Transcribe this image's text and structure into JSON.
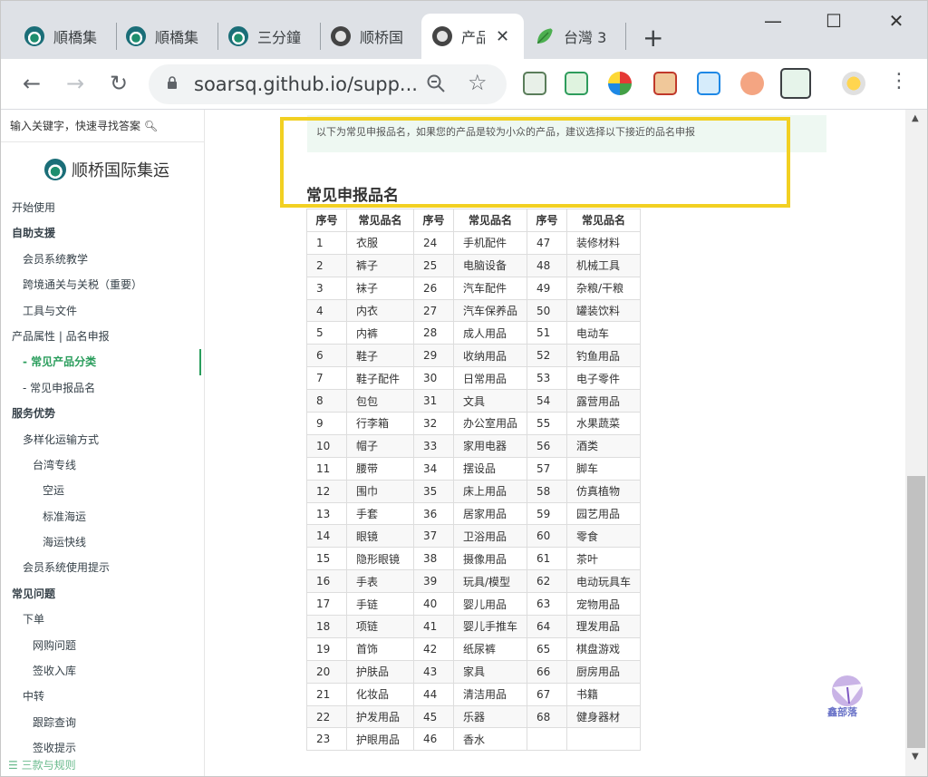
{
  "browser": {
    "tabs": [
      {
        "title": "順橋集",
        "icon": "boat-logo-icon",
        "active": false
      },
      {
        "title": "順橋集",
        "icon": "boat-logo-icon",
        "active": false
      },
      {
        "title": "三分鐘",
        "icon": "boat-logo-icon",
        "active": false
      },
      {
        "title": "顺桥国",
        "icon": "globe-icon",
        "active": false
      },
      {
        "title": "产品",
        "icon": "globe-icon",
        "active": true
      },
      {
        "title": "台灣 3",
        "icon": "leaf-icon",
        "active": false
      }
    ],
    "url": "soarsq.github.io/supp...",
    "window_controls": {
      "minimize": "—",
      "maximize": "☐",
      "close": "✕"
    }
  },
  "sidebar": {
    "search_placeholder": "输入关键字，快速寻找答案",
    "logo_text": "顺桥国际集运",
    "items": [
      {
        "label": "开始使用",
        "level": 0,
        "bold": false
      },
      {
        "label": "自助支援",
        "level": 0,
        "bold": true
      },
      {
        "label": "会员系统教学",
        "level": 1,
        "bold": false
      },
      {
        "label": "跨境通关与关税（重要）",
        "level": 1,
        "bold": false
      },
      {
        "label": "工具与文件",
        "level": 1,
        "bold": false
      },
      {
        "label": "产品属性 | 品名申报",
        "level": 0,
        "bold": false
      },
      {
        "label": "- 常见产品分类",
        "level": 1,
        "bold": true,
        "active": true
      },
      {
        "label": "- 常见申报品名",
        "level": 1,
        "bold": false
      },
      {
        "label": "服务优势",
        "level": 0,
        "bold": true
      },
      {
        "label": "多样化运输方式",
        "level": 1,
        "bold": false
      },
      {
        "label": "台湾专线",
        "level": 2,
        "bold": false
      },
      {
        "label": "空运",
        "level": 3,
        "bold": false
      },
      {
        "label": "标准海运",
        "level": 3,
        "bold": false
      },
      {
        "label": "海运快线",
        "level": 3,
        "bold": false
      },
      {
        "label": "会员系统使用提示",
        "level": 1,
        "bold": false
      },
      {
        "label": "常见问题",
        "level": 0,
        "bold": true
      },
      {
        "label": "下单",
        "level": 1,
        "bold": false
      },
      {
        "label": "网购问题",
        "level": 2,
        "bold": false
      },
      {
        "label": "签收入库",
        "level": 2,
        "bold": false
      },
      {
        "label": "中转",
        "level": 1,
        "bold": false
      },
      {
        "label": "跟踪查询",
        "level": 2,
        "bold": false
      },
      {
        "label": "签收提示",
        "level": 2,
        "bold": false
      }
    ],
    "footer": "三款与规则"
  },
  "content": {
    "notice": "以下为常见申报品名，如果您的产品是较为小众的产品，建议选择以下接近的品名申报",
    "section_title": "常见申报品名",
    "table": {
      "headers": [
        "序号",
        "常见品名",
        "序号",
        "常见品名",
        "序号",
        "常见品名"
      ],
      "rows": [
        [
          "1",
          "衣服",
          "24",
          "手机配件",
          "47",
          "装修材料"
        ],
        [
          "2",
          "裤子",
          "25",
          "电脑设备",
          "48",
          "机械工具"
        ],
        [
          "3",
          "袜子",
          "26",
          "汽车配件",
          "49",
          "杂粮/干粮"
        ],
        [
          "4",
          "内衣",
          "27",
          "汽车保养品",
          "50",
          "罐装饮料"
        ],
        [
          "5",
          "内裤",
          "28",
          "成人用品",
          "51",
          "电动车"
        ],
        [
          "6",
          "鞋子",
          "29",
          "收纳用品",
          "52",
          "钓鱼用品"
        ],
        [
          "7",
          "鞋子配件",
          "30",
          "日常用品",
          "53",
          "电子零件"
        ],
        [
          "8",
          "包包",
          "31",
          "文具",
          "54",
          "露营用品"
        ],
        [
          "9",
          "行李箱",
          "32",
          "办公室用品",
          "55",
          "水果蔬菜"
        ],
        [
          "10",
          "帽子",
          "33",
          "家用电器",
          "56",
          "酒类"
        ],
        [
          "11",
          "腰带",
          "34",
          "摆设品",
          "57",
          "脚车"
        ],
        [
          "12",
          "围巾",
          "35",
          "床上用品",
          "58",
          "仿真植物"
        ],
        [
          "13",
          "手套",
          "36",
          "居家用品",
          "59",
          "园艺用品"
        ],
        [
          "14",
          "眼镜",
          "37",
          "卫浴用品",
          "60",
          "零食"
        ],
        [
          "15",
          "隐形眼镜",
          "38",
          "摄像用品",
          "61",
          "茶叶"
        ],
        [
          "16",
          "手表",
          "39",
          "玩具/模型",
          "62",
          "电动玩具车"
        ],
        [
          "17",
          "手链",
          "40",
          "婴儿用品",
          "63",
          "宠物用品"
        ],
        [
          "18",
          "项链",
          "41",
          "婴儿手推车",
          "64",
          "理发用品"
        ],
        [
          "19",
          "首饰",
          "42",
          "纸尿裤",
          "65",
          "棋盘游戏"
        ],
        [
          "20",
          "护肤品",
          "43",
          "家具",
          "66",
          "厨房用品"
        ],
        [
          "21",
          "化妆品",
          "44",
          "清洁用品",
          "67",
          "书籍"
        ],
        [
          "22",
          "护发用品",
          "45",
          "乐器",
          "68",
          "健身器材"
        ],
        [
          "23",
          "护眼用品",
          "46",
          "香水",
          "",
          ""
        ]
      ]
    },
    "watermark": "鑫部落"
  },
  "colors": {
    "accent": "#2a9d5c",
    "highlight": "#f2d022",
    "notice_bg": "#eef8f2"
  }
}
